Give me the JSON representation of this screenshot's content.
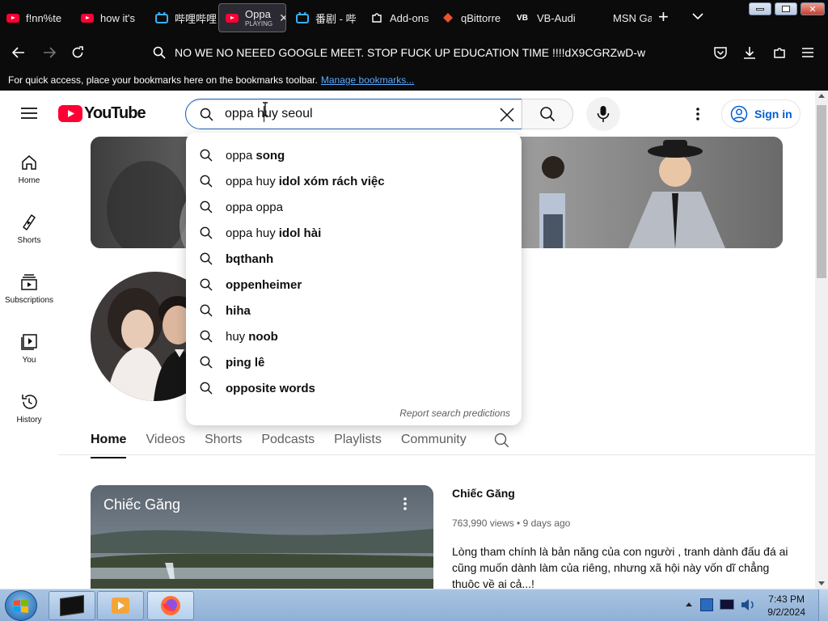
{
  "browser": {
    "tabs": [
      {
        "label": "f!nn%te",
        "icon": "youtube-icon"
      },
      {
        "label": "how it's",
        "icon": "youtube-icon"
      },
      {
        "label": "哔哩哔哩",
        "icon": "bilibili-icon"
      },
      {
        "label": "Oppa",
        "sub": "PLAYING",
        "icon": "youtube-icon",
        "active": true
      },
      {
        "label": "番剧 - 哔",
        "icon": "bilibili-icon"
      },
      {
        "label": "Add-ons",
        "icon": "puzzle-icon"
      },
      {
        "label": "qBittorre",
        "icon": "qbittorrent-icon"
      },
      {
        "label": "VB-Audi",
        "icon": "vb-icon"
      },
      {
        "label": "MSN Ga",
        "icon": "msn-icon"
      }
    ],
    "new_tab": "+",
    "url": "NO WE NO NEEED GOOGLE MEET. STOP FUCK UP EDUCATION TIME !!!!dX9CGRZwD-w",
    "bookmarks_text": "For quick access, place your bookmarks here on the bookmarks toolbar.",
    "bookmarks_link": "Manage bookmarks..."
  },
  "youtube": {
    "logo": "YouTube",
    "search_value": "oppa huy seoul",
    "sign_in": "Sign in",
    "sidebar": [
      {
        "label": "Home",
        "icon": "home-icon"
      },
      {
        "label": "Shorts",
        "icon": "shorts-icon"
      },
      {
        "label": "Subscriptions",
        "icon": "subscriptions-icon"
      },
      {
        "label": "You",
        "icon": "you-icon"
      },
      {
        "label": "History",
        "icon": "history-icon"
      }
    ],
    "suggestions": [
      {
        "plain": "oppa",
        "bold": "song"
      },
      {
        "plain": "oppa huy",
        "bold": "idol xóm rách việc"
      },
      {
        "plain": "oppa oppa",
        "bold": ""
      },
      {
        "plain": "oppa huy",
        "bold": "idol hài"
      },
      {
        "plain": "",
        "bold": "bqthanh"
      },
      {
        "plain": "",
        "bold": "oppenheimer"
      },
      {
        "plain": "",
        "bold": "hiha"
      },
      {
        "plain": "huy",
        "bold": "noob"
      },
      {
        "plain": "",
        "bold": "ping lê"
      },
      {
        "plain": "",
        "bold": "opposite words"
      }
    ],
    "report_predictions": "Report search predictions",
    "channel_tabs": [
      "Home",
      "Videos",
      "Shorts",
      "Podcasts",
      "Playlists",
      "Community"
    ],
    "selected_tab": "Home",
    "video": {
      "title_overlay": "Chiếc Găng",
      "title": "Chiếc Găng",
      "views": "763,990 views",
      "age": "9 days ago",
      "description": "Lòng tham chính là bản năng  của con người , tranh dành đấu đá ai cũng muốn dành làm của riêng, nhưng xã hội này vốn dĩ chẳng thuộc về ai cả...!"
    }
  },
  "taskbar": {
    "time": "7:43 PM",
    "date": "9/2/2024"
  },
  "colors": {
    "accent": "#065fd4",
    "youtube_red": "#ff0033",
    "chrome": "#0b0b0b"
  }
}
